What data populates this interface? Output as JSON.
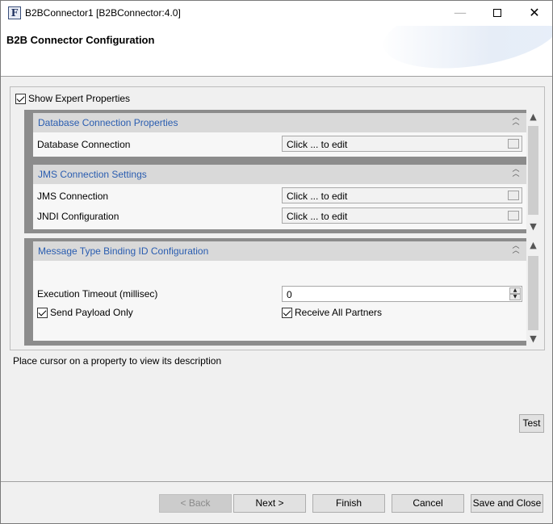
{
  "window": {
    "title": "B2BConnector1 [B2BConnector:4.0]",
    "app_icon_glyph": "F",
    "minimize_glyph": "—",
    "close_glyph": "✕"
  },
  "header": {
    "title": "B2B Connector Configuration"
  },
  "options": {
    "show_expert_label": "Show Expert Properties",
    "show_expert_checked": true
  },
  "sections": {
    "database": {
      "title": "Database Connection Properties",
      "props": [
        {
          "label": "Database Connection",
          "value": "Click ... to edit"
        }
      ]
    },
    "jms": {
      "title": "JMS Connection Settings",
      "props": [
        {
          "label": "JMS Connection",
          "value": "Click ... to edit"
        },
        {
          "label": "JNDI Configuration",
          "value": "Click ... to edit"
        }
      ]
    },
    "message": {
      "title": "Message Type Binding ID Configuration",
      "timeout_label": "Execution Timeout (millisec)",
      "timeout_value": "0",
      "send_payload_label": "Send Payload Only",
      "send_payload_checked": true,
      "receive_all_label": "Receive All Partners",
      "receive_all_checked": true
    }
  },
  "icons": {
    "collapse": "chevron-double-up-icon",
    "scroll_up": "▲",
    "scroll_down": "▼"
  },
  "description": "Place cursor on a property to view its description",
  "buttons": {
    "test": "Test",
    "back": "< Back",
    "next": "Next >",
    "finish": "Finish",
    "cancel": "Cancel",
    "save_close": "Save and Close"
  }
}
